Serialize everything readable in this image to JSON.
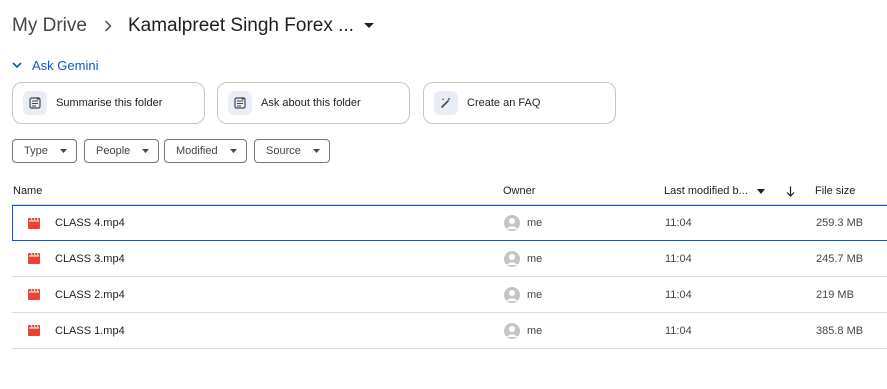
{
  "breadcrumb": {
    "root": "My Drive",
    "current": "Kamalpreet Singh Forex ..."
  },
  "gemini": {
    "label": "Ask Gemini"
  },
  "suggestions": [
    {
      "label": "Summarise this folder",
      "icon": "summarize-icon"
    },
    {
      "label": "Ask about this folder",
      "icon": "ask-icon"
    },
    {
      "label": "Create an FAQ",
      "icon": "magic-pen-icon"
    }
  ],
  "filters": {
    "type": "Type",
    "people": "People",
    "modified": "Modified",
    "source": "Source"
  },
  "table": {
    "headers": {
      "name": "Name",
      "owner": "Owner",
      "modified": "Last modified b...",
      "size": "File size"
    },
    "rows": [
      {
        "name": "CLASS 4.mp4",
        "owner": "me",
        "modified": "11:04",
        "size": "259.3 MB"
      },
      {
        "name": "CLASS 3.mp4",
        "owner": "me",
        "modified": "11:04",
        "size": "245.7 MB"
      },
      {
        "name": "CLASS 2.mp4",
        "owner": "me",
        "modified": "11:04",
        "size": "219 MB"
      },
      {
        "name": "CLASS 1.mp4",
        "owner": "me",
        "modified": "11:04",
        "size": "385.8 MB"
      }
    ]
  },
  "colors": {
    "accent": "#0b57d0",
    "video_icon": "#ea4335",
    "border": "#dadce0"
  }
}
